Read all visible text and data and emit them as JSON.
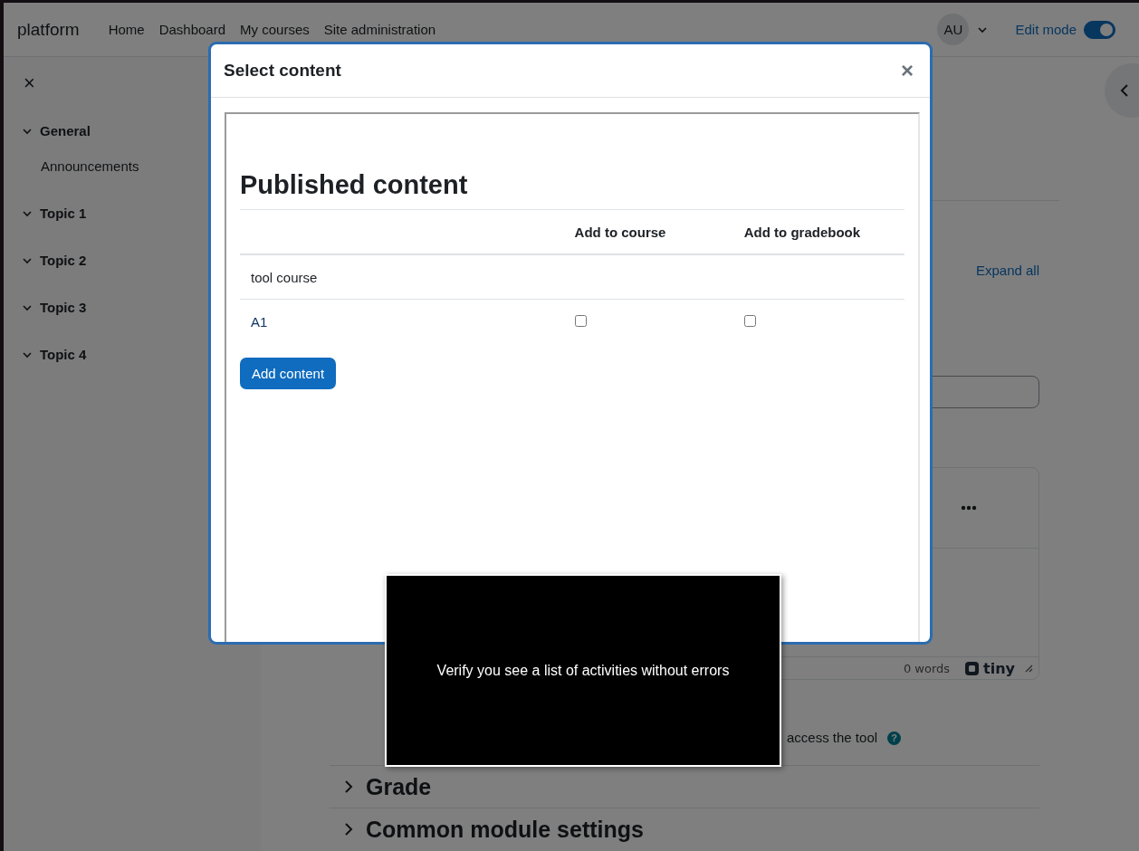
{
  "navbar": {
    "brand": "platform",
    "links": [
      "Home",
      "Dashboard",
      "My courses",
      "Site administration"
    ],
    "avatar": "AU",
    "edit_mode": {
      "label": "Edit mode",
      "on": true
    }
  },
  "drawer": {
    "close": "×",
    "sections": [
      {
        "title": "General",
        "expanded": true,
        "children": [
          {
            "title": "Announcements"
          }
        ]
      },
      {
        "title": "Topic 1",
        "expanded": true
      },
      {
        "title": "Topic 2",
        "expanded": true
      },
      {
        "title": "Topic 3",
        "expanded": true
      },
      {
        "title": "Topic 4",
        "expanded": true
      }
    ]
  },
  "main": {
    "expand_all": "Expand all",
    "editor": {
      "word_count": "0 words",
      "brand": "tiny"
    },
    "help_label": "access the tool",
    "help_glyph": "?",
    "sections": [
      {
        "title": "Grade",
        "expanded": false
      },
      {
        "title": "Common module settings",
        "expanded": false
      }
    ]
  },
  "modal": {
    "title": "Select content",
    "close": "×",
    "heading": "Published content",
    "columns": [
      "Add to course",
      "Add to gradebook"
    ],
    "rows": [
      {
        "kind": "group",
        "label": "tool course"
      },
      {
        "kind": "item",
        "label": "A1",
        "add_to_course": false,
        "add_to_gradebook": false
      }
    ],
    "button": "Add content"
  },
  "caption": "Verify you see a list of activities without errors"
}
